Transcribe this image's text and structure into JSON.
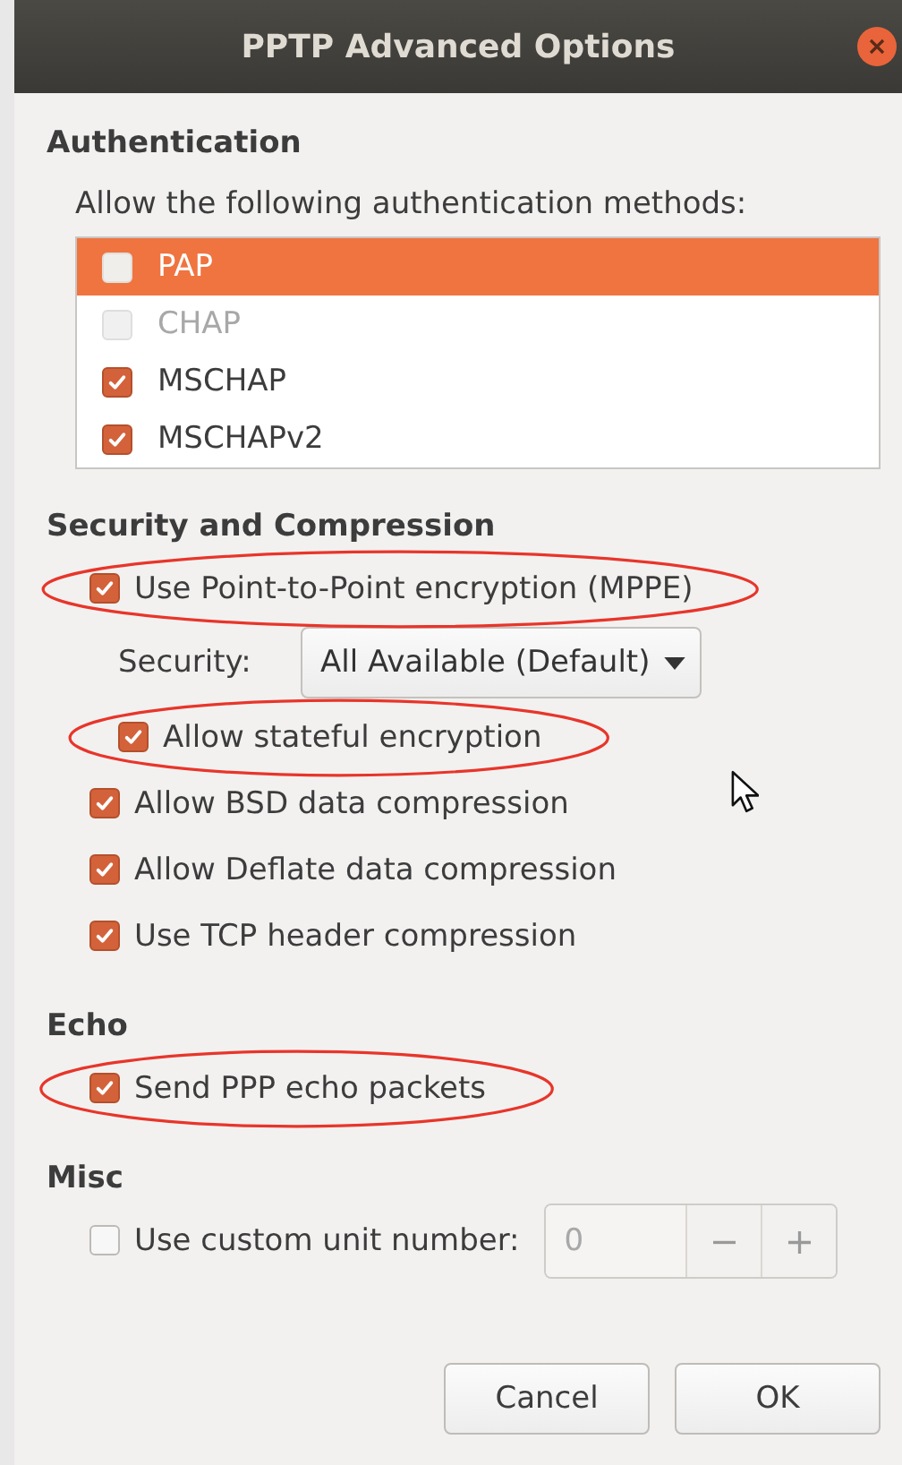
{
  "window": {
    "title": "PPTP Advanced Options"
  },
  "authentication": {
    "heading": "Authentication",
    "description": "Allow the following authentication methods:",
    "methods": [
      {
        "label": "PAP",
        "checked": false,
        "selected": true,
        "disabled": false
      },
      {
        "label": "CHAP",
        "checked": false,
        "selected": false,
        "disabled": true
      },
      {
        "label": "MSCHAP",
        "checked": true,
        "selected": false,
        "disabled": false
      },
      {
        "label": "MSCHAPv2",
        "checked": true,
        "selected": false,
        "disabled": false
      }
    ]
  },
  "security": {
    "heading": "Security and Compression",
    "options": [
      {
        "kind": "checkbox",
        "label": "Use Point-to-Point encryption (MPPE)",
        "checked": true,
        "highlighted": true,
        "children": [
          {
            "kind": "dropdown",
            "label": "Security:",
            "value": "All Available (Default)"
          },
          {
            "kind": "checkbox",
            "label": "Allow stateful encryption",
            "checked": true,
            "highlighted": true
          }
        ]
      },
      {
        "kind": "checkbox",
        "label": "Allow BSD data compression",
        "checked": true,
        "highlighted": false
      },
      {
        "kind": "checkbox",
        "label": "Allow Deflate data compression",
        "checked": true,
        "highlighted": false
      },
      {
        "kind": "checkbox",
        "label": "Use TCP header compression",
        "checked": true,
        "highlighted": false
      }
    ]
  },
  "echo": {
    "heading": "Echo",
    "options": [
      {
        "kind": "checkbox",
        "label": "Send PPP echo packets",
        "checked": true,
        "highlighted": true
      }
    ]
  },
  "misc": {
    "heading": "Misc",
    "options": [
      {
        "kind": "spin",
        "label": "Use custom unit number:",
        "checked": false,
        "highlighted": false,
        "value": "0",
        "disabled": true,
        "decrement": "−",
        "increment": "+"
      }
    ]
  },
  "buttons": [
    {
      "label": "Cancel"
    },
    {
      "label": "OK"
    }
  ]
}
